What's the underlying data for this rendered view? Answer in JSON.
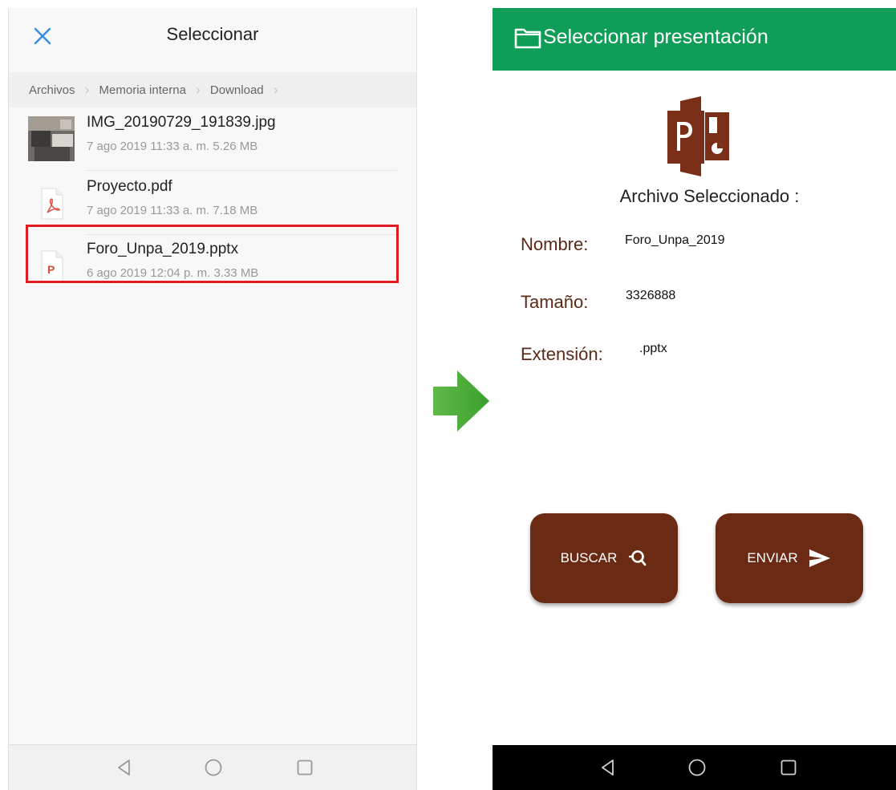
{
  "picker": {
    "title": "Seleccionar",
    "breadcrumb": [
      "Archivos",
      "Memoria interna",
      "Download"
    ],
    "files": [
      {
        "name": "IMG_20190729_191839.jpg",
        "meta": "7 ago 2019 11:33 a. m. 5.26 MB",
        "icon": "image-thumbnail"
      },
      {
        "name": "Proyecto.pdf",
        "meta": "7 ago 2019 11:33 a. m. 7.18 MB",
        "icon": "pdf-icon"
      },
      {
        "name": "Foro_Unpa_2019.pptx",
        "meta": "6 ago 2019 12:04 p. m. 3.33 MB",
        "icon": "pptx-icon",
        "highlighted": true
      }
    ],
    "accent_color": "#3a8ee6",
    "highlight_color": "#e01c22"
  },
  "app": {
    "title": "Seleccionar presentación",
    "bar_color": "#0f9d58",
    "heading": "Archivo Seleccionado :",
    "name_label": "Nombre:",
    "name_value": "Foro_Unpa_2019",
    "size_label": "Tamaño:",
    "size_value": "3326888",
    "ext_label": "Extensión:",
    "ext_value": ".pptx",
    "search_label": "BUSCAR",
    "send_label": "ENVIAR",
    "button_color": "#6b2a13"
  },
  "arrow_color": "#4caf2e"
}
